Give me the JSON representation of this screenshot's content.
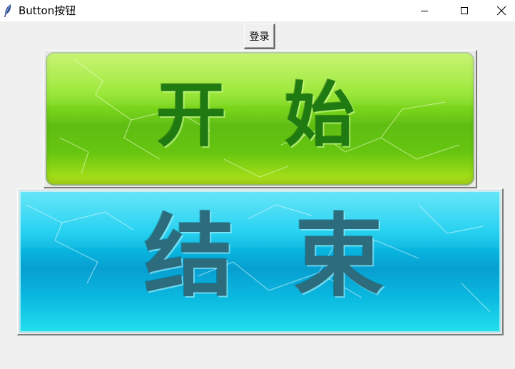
{
  "window": {
    "title": "Button按钮",
    "app_icon": "feather-icon",
    "controls": {
      "minimize_icon": "minimize-icon",
      "maximize_icon": "maximize-icon",
      "close_icon": "close-icon"
    }
  },
  "buttons": {
    "login_label": "登录",
    "start": {
      "chars": [
        "开",
        "始"
      ],
      "colors": {
        "accent": "#74d11a",
        "text": "#1f7a12"
      }
    },
    "end": {
      "chars": [
        "结",
        "束"
      ],
      "colors": {
        "accent": "#08b0dc",
        "text": "#2d6c7c"
      }
    }
  },
  "colors": {
    "window_bg": "#f0f0f0",
    "titlebar_bg": "#ffffff"
  }
}
